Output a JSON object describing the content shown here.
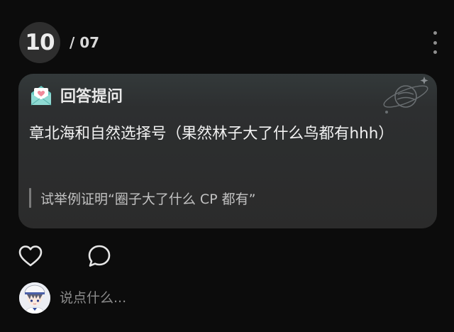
{
  "header": {
    "day": "10",
    "month": "/ 07"
  },
  "card": {
    "title": "回答提问",
    "answer": "章北海和自然选择号（果然林子大了什么鸟都有hhh）",
    "question": "试举例证明“圈子大了什么 CP 都有”"
  },
  "comment": {
    "placeholder": "说点什么..."
  },
  "icons": {
    "menu": "more-vertical-icon",
    "card": "mail-heart-icon",
    "decor": "planet-icon",
    "like": "heart-icon",
    "comment": "chat-bubble-icon",
    "avatar": "user-avatar"
  },
  "colors": {
    "background": "#0c0c0c",
    "card_background": "#2b2b2b",
    "badge_background": "#2e2e2e",
    "mail_icon_teal": "#69c8c1",
    "mail_icon_pink": "#f08a9a"
  }
}
